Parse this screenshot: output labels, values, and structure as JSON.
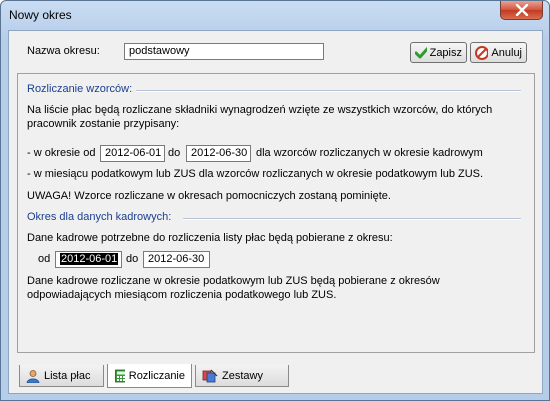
{
  "window": {
    "title": "Nowy okres"
  },
  "header": {
    "name_label": "Nazwa okresu:",
    "name_value": "podstawowy",
    "save_label": "Zapisz",
    "cancel_label": "Anuluj"
  },
  "templates": {
    "heading": "Rozliczanie wzorców:",
    "desc_line1": "Na liście płac będą rozliczane składniki wynagrodzeń wzięte ze wszystkich wzorców, do których",
    "desc_line2": "pracownik zostanie przypisany:",
    "period_prefix": "- w okresie od",
    "from": "2012-06-01",
    "to_label": "do",
    "to": "2012-06-30",
    "period_suffix": "dla wzorców rozliczanych w okresie kadrowym",
    "tax_line": "- w miesiącu podatkowym lub ZUS dla wzorców rozliczanych w okresie podatkowym lub ZUS.",
    "warning": "UWAGA! Wzorce rozliczane w okresach pomocniczych zostaną pominięte."
  },
  "hr": {
    "heading": "Okres dla danych kadrowych:",
    "desc": "Dane kadrowe potrzebne do rozliczenia listy płac będą pobierane z okresu:",
    "from_label": "od",
    "from": "2012-06-01",
    "to_label": "do",
    "to": "2012-06-30",
    "note_line1": "Dane kadrowe rozliczane w okresie podatkowym lub ZUS będą pobierane z okresów",
    "note_line2": "odpowiadających miesiącom rozliczenia podatkowego lub ZUS."
  },
  "tabs": [
    {
      "label": "Lista płac"
    },
    {
      "label": "Rozliczanie"
    },
    {
      "label": "Zestawy"
    }
  ]
}
